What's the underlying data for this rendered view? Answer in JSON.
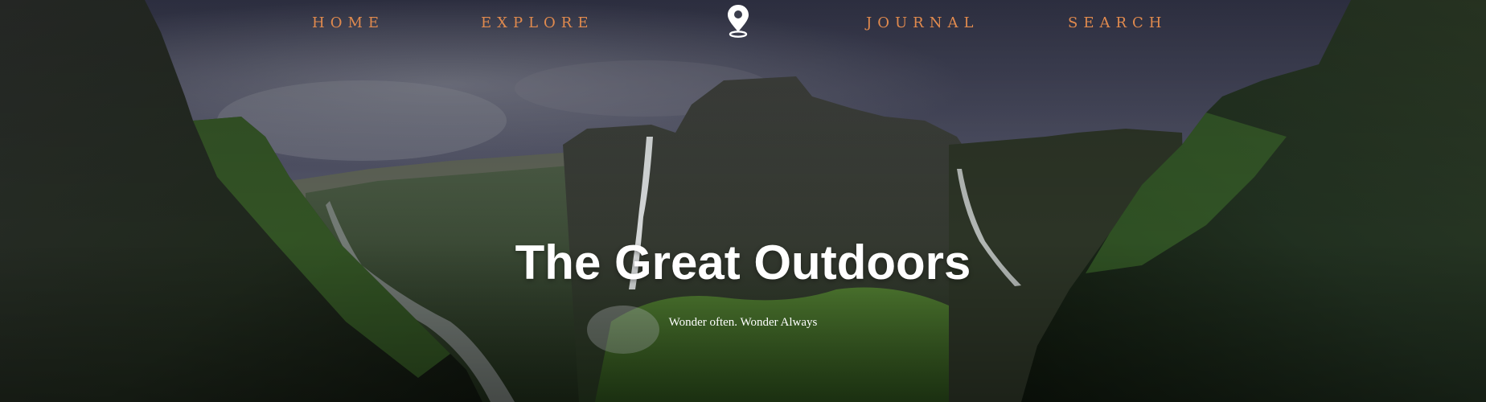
{
  "nav": {
    "home_label": "HOME",
    "explore_label": "EXPLORE",
    "journal_label": "JOURNAL",
    "search_label": "SEARCH",
    "logo_icon": "map-pin-icon",
    "link_color": "#e08a4e"
  },
  "hero": {
    "title": "The Great Outdoors",
    "subtitle": "Wonder often. Wonder Always"
  }
}
